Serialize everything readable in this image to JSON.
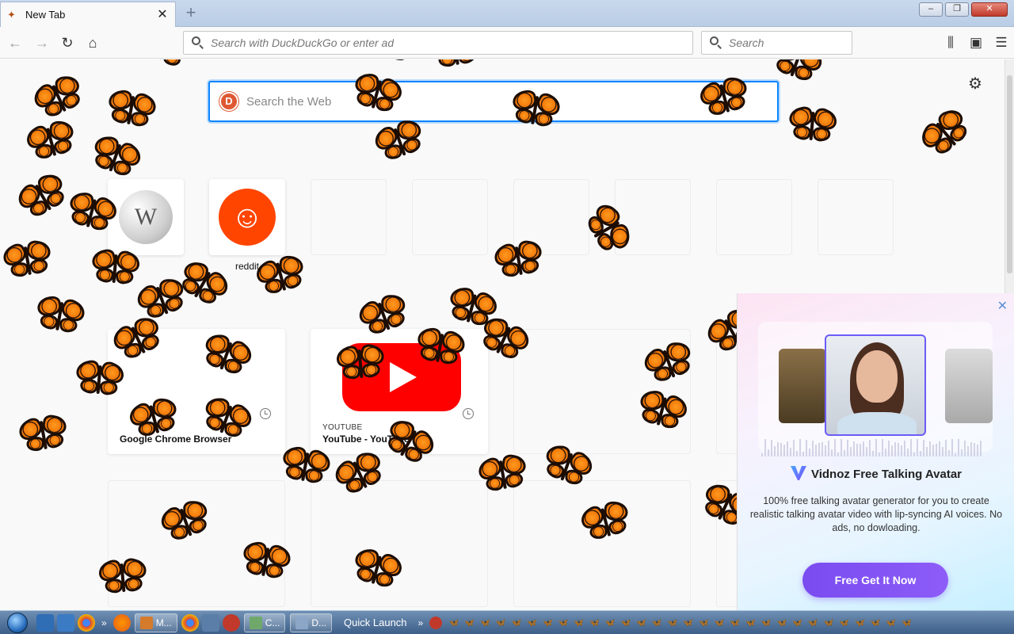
{
  "browser": {
    "tab": {
      "title": "New Tab",
      "close_symbol": "✕"
    },
    "new_tab_symbol": "+",
    "window_controls": [
      "–",
      "❐",
      "✕"
    ],
    "nav": {
      "back": "←",
      "forward": "→",
      "reload": "↻",
      "home": "⌂"
    },
    "urlbar": {
      "placeholder": "Search with DuckDuckGo or enter address",
      "visible_text": "Search with DuckDuckGo or enter ad"
    },
    "searchbar": {
      "placeholder": "Search"
    },
    "toolbar_right": {
      "library": "⫼",
      "sidebar": "▣",
      "menu": "☰"
    }
  },
  "newtab": {
    "settings_icon": "⚙",
    "web_search": {
      "placeholder": "Search the Web",
      "engine_badge": "D"
    },
    "top_sites": [
      {
        "label": "",
        "icon": "wikipedia-icon",
        "glyph": "W"
      },
      {
        "label": "reddit",
        "icon": "reddit-icon",
        "glyph": "☺"
      },
      {
        "label": "",
        "empty": true
      },
      {
        "label": "",
        "empty": true
      },
      {
        "label": "",
        "empty": true
      },
      {
        "label": "",
        "empty": true
      },
      {
        "label": "",
        "empty": true
      },
      {
        "label": "",
        "empty": true
      }
    ],
    "highlights": [
      {
        "source": "",
        "title": "Google Chrome Browser"
      },
      {
        "source": "YOUTUBE",
        "title": "YouTube - YouTube"
      },
      {
        "source": "",
        "title": ""
      }
    ]
  },
  "ad": {
    "close_symbol": "✕",
    "title": "Vidnoz Free Talking Avatar",
    "description": "100% free talking avatar generator for you to create realistic talking avatar video with lip-syncing AI voices. No ads, no dowloading.",
    "cta": "Free Get It Now"
  },
  "taskbar": {
    "tasks": [
      {
        "label": "M..."
      },
      {
        "label": "C..."
      },
      {
        "label": "D..."
      }
    ],
    "quick_launch": "Quick Launch",
    "chevron": "»",
    "tray_icon": "🦋"
  },
  "colors": {
    "accent": "#0a84ff",
    "ddg": "#de5833",
    "reddit": "#ff4500",
    "youtube": "#ff0000",
    "butterfly": "#f27a0a",
    "cta": "#7a4cf0"
  }
}
